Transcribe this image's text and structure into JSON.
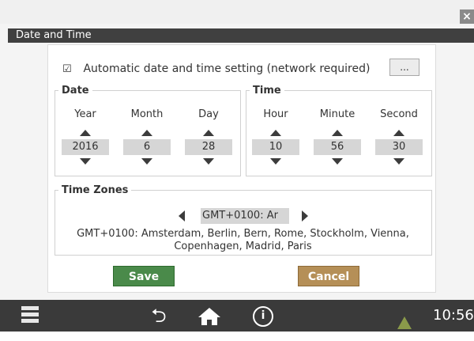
{
  "window": {
    "title": "Date and Time",
    "close_glyph": "×"
  },
  "auto": {
    "checked": true,
    "check_glyph": "☑",
    "label": "Automatic date and time setting (network required)",
    "more_label": "..."
  },
  "date": {
    "legend": "Date",
    "fields": [
      {
        "label": "Year",
        "value": "2016"
      },
      {
        "label": "Month",
        "value": "6"
      },
      {
        "label": "Day",
        "value": "28"
      }
    ]
  },
  "time": {
    "legend": "Time",
    "fields": [
      {
        "label": "Hour",
        "value": "10"
      },
      {
        "label": "Minute",
        "value": "56"
      },
      {
        "label": "Second",
        "value": "30"
      }
    ]
  },
  "timezones": {
    "legend": "Time Zones",
    "selected": "GMT+0100:  Ar",
    "description": "GMT+0100:  Amsterdam, Berlin, Bern, Rome, Stockholm, Vienna, Copenhagen, Madrid, Paris"
  },
  "actions": {
    "save_label": "Save",
    "cancel_label": "Cancel"
  },
  "taskbar": {
    "icons": [
      "menu-icon",
      "back-icon",
      "home-icon",
      "info-icon",
      "warning-icon"
    ],
    "back_glyph": "⮌",
    "info_glyph": "i",
    "clock": "10:56"
  },
  "colors": {
    "title_bar": "#404040",
    "save": "#4a8a4a",
    "cancel": "#b58f57",
    "taskbar": "#3a3a3a",
    "warning": "#8a9a4a"
  }
}
